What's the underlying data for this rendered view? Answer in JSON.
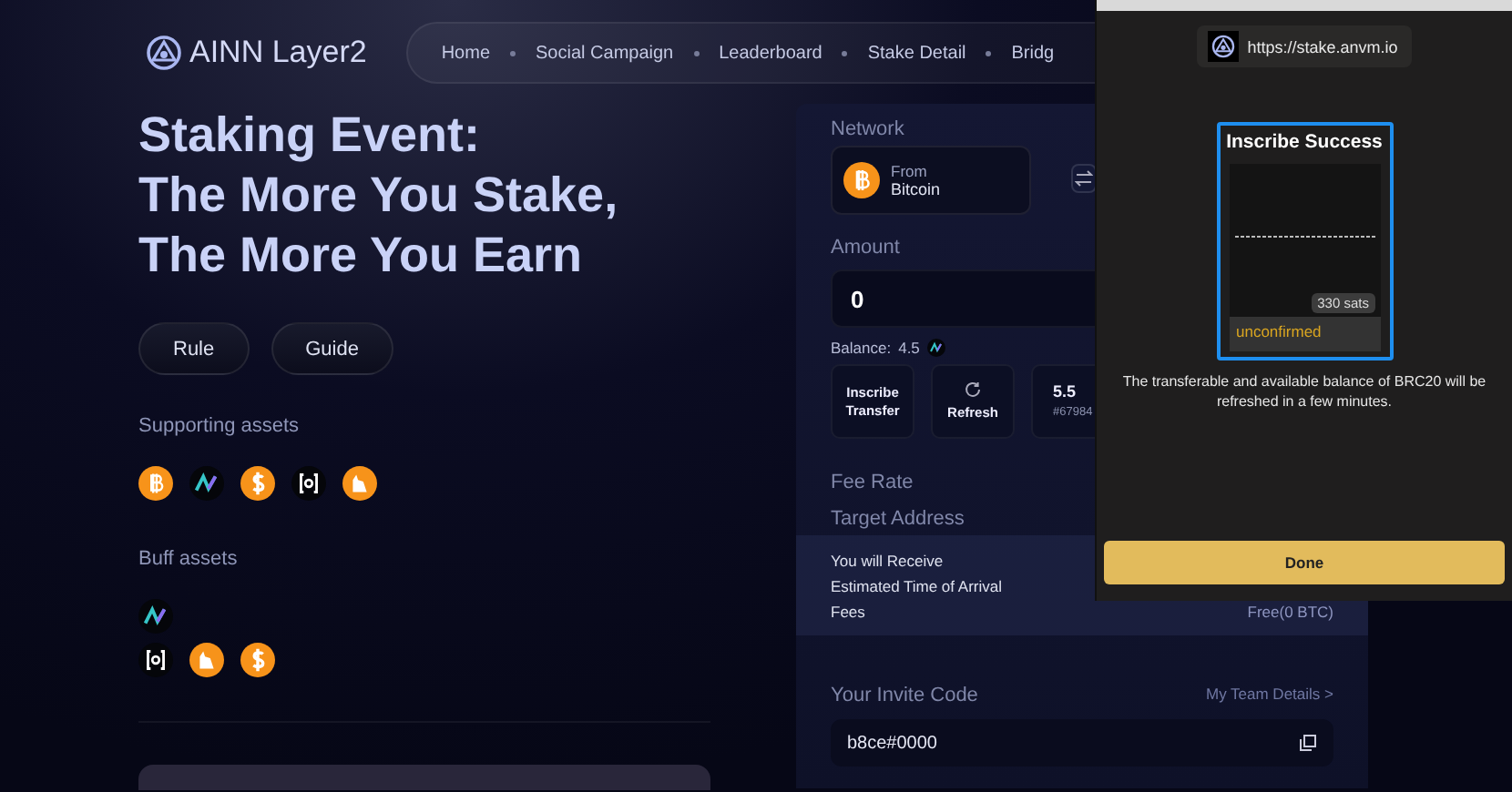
{
  "header": {
    "logo": "AINN Layer2",
    "nav": [
      {
        "label": "Home"
      },
      {
        "label": "Social Campaign"
      },
      {
        "label": "Leaderboard"
      },
      {
        "label": "Stake Detail"
      },
      {
        "label": "Bridg"
      }
    ]
  },
  "hero": {
    "title_lines": [
      "Staking Event:",
      "The More You Stake,",
      "The More You Earn"
    ],
    "buttons": [
      "Rule",
      "Guide"
    ],
    "supporting_assets": {
      "label": "Supporting assets",
      "rows": [
        [
          {
            "kind": "bitcoin"
          },
          {
            "kind": "ainn"
          },
          {
            "kind": "dollar"
          },
          {
            "kind": "bracket"
          },
          {
            "kind": "cat"
          }
        ]
      ]
    },
    "buff_assets": {
      "label": "Buff assets",
      "rows": [
        [
          {
            "kind": "ainn"
          }
        ],
        [
          {
            "kind": "bracket"
          },
          {
            "kind": "cat"
          },
          {
            "kind": "dollar"
          }
        ]
      ]
    }
  },
  "stake": {
    "network_label": "Network",
    "from": {
      "caption": "From",
      "name": "Bitcoin"
    },
    "amount_label": "Amount",
    "amount_value": "0",
    "balance_label": "Balance:",
    "balance_value": "4.5",
    "tiles": [
      {
        "kind": "inscribe",
        "label": "Inscribe Transfer"
      },
      {
        "kind": "refresh",
        "label": "Refresh"
      },
      {
        "kind": "inscription",
        "value": "5.5",
        "id": "#67984"
      }
    ],
    "fee_rate_label": "Fee Rate",
    "target_address_label": "Target Address",
    "summary": [
      {
        "label": "You will Receive"
      },
      {
        "label": "Estimated Time of Arrival"
      },
      {
        "label": "Fees",
        "value": "Free(0 BTC)"
      }
    ],
    "invite_label": "Your Invite Code",
    "team_link": "My Team Details >",
    "invite_code": "b8ce#0000"
  },
  "popup": {
    "url": "https://stake.anvm.io",
    "title": "Inscribe Success",
    "sats": "330 sats",
    "status": "unconfirmed",
    "message": "The transferable and available balance of BRC20 will be refreshed in a few minutes.",
    "done": "Done"
  }
}
